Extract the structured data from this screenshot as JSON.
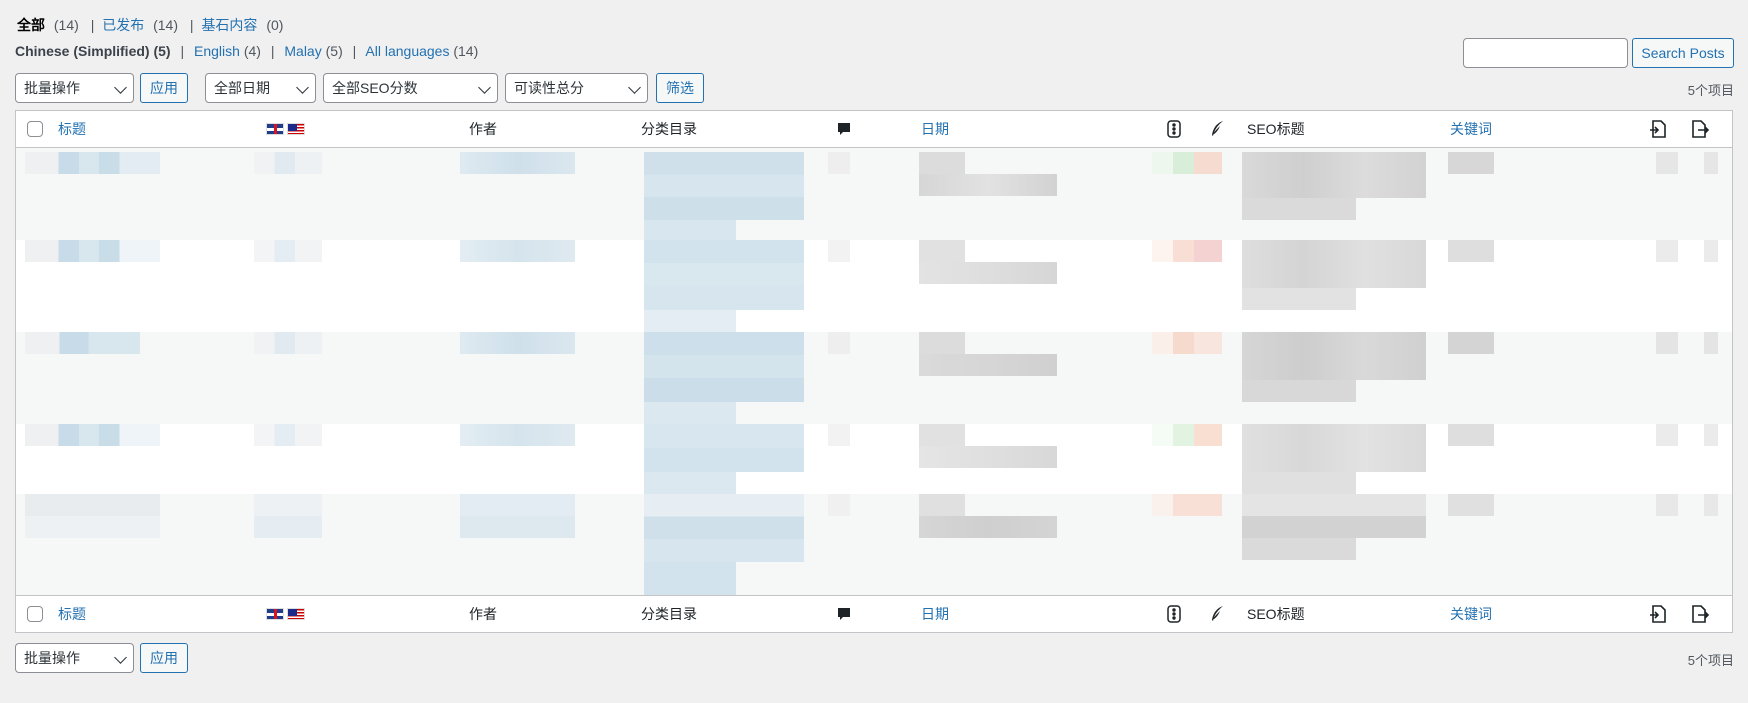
{
  "views": [
    {
      "label": "全部",
      "count": "(14)",
      "current": true
    },
    {
      "label": "已发布",
      "count": "(14)"
    },
    {
      "label": "基石内容",
      "count": "(0)"
    }
  ],
  "languages": [
    {
      "label": "Chinese (Simplified)",
      "count": "(5)",
      "current": true
    },
    {
      "label": "English",
      "count": "(4)"
    },
    {
      "label": "Malay",
      "count": "(5)"
    },
    {
      "label": "All languages",
      "count": "(14)"
    }
  ],
  "search": {
    "value": "",
    "button": "Search Posts"
  },
  "top_nav": {
    "bulk": "批量操作",
    "apply": "应用",
    "date_filter": "全部日期",
    "seo_filter": "全部SEO分数",
    "readability_filter": "可读性总分",
    "filter_btn": "筛选",
    "count": "5个项目"
  },
  "columns": {
    "title": "标题",
    "author": "作者",
    "categories": "分类目录",
    "date": "日期",
    "seo_title": "SEO标题",
    "keyword": "关键词",
    "flags": [
      "gb-flag-icon",
      "my-flag-icon"
    ],
    "icons": [
      "comment-icon",
      "traffic-light-icon",
      "feather-icon",
      "inbound-links-icon",
      "outbound-links-icon"
    ]
  },
  "bottom_nav": {
    "bulk": "批量操作",
    "apply": "应用",
    "count": "5个项目"
  },
  "colors": {
    "accent": "#2271b1",
    "bg": "#f0f0f1",
    "blur_blue": "#c9dde9",
    "blur_grey": "#d9d9d9"
  }
}
